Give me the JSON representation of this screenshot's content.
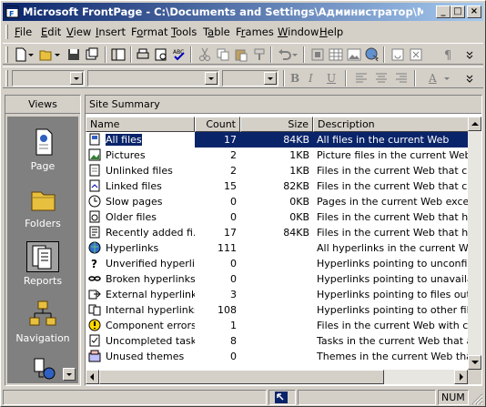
{
  "window": {
    "title": "Microsoft FrontPage - C:\\Documents and Settings\\Администратор\\Мои доку...",
    "minimize": "_",
    "maximize": "□",
    "close": "×"
  },
  "menu": [
    {
      "label": "File",
      "accel": "F"
    },
    {
      "label": "Edit",
      "accel": "E"
    },
    {
      "label": "View",
      "accel": "V"
    },
    {
      "label": "Insert",
      "accel": "I"
    },
    {
      "label": "Format",
      "accel": "o"
    },
    {
      "label": "Tools",
      "accel": "T"
    },
    {
      "label": "Table",
      "accel": "a"
    },
    {
      "label": "Frames",
      "accel": "r"
    },
    {
      "label": "Window",
      "accel": "W"
    },
    {
      "label": "Help",
      "accel": "H"
    }
  ],
  "format_toolbar": {
    "bold": "B",
    "italic": "I",
    "underline": "U",
    "font_color": "A"
  },
  "views": {
    "header": "Views",
    "items": [
      {
        "label": "Page",
        "icon": "page-icon"
      },
      {
        "label": "Folders",
        "icon": "folder-icon"
      },
      {
        "label": "Reports",
        "icon": "reports-icon",
        "selected": true
      },
      {
        "label": "Navigation",
        "icon": "navigation-icon"
      },
      {
        "label": "",
        "icon": "hyperlinks-view-icon"
      }
    ]
  },
  "report": {
    "title": "Site Summary",
    "columns": [
      "Name",
      "Count",
      "Size",
      "Description"
    ],
    "rows": [
      {
        "name": "All files",
        "count": "17",
        "size": "84KB",
        "description": "All files in the current Web",
        "icon": "all-files-icon",
        "selected": true
      },
      {
        "name": "Pictures",
        "count": "2",
        "size": "1KB",
        "description": "Picture files in the current Web (GIF, ",
        "icon": "pictures-icon"
      },
      {
        "name": "Unlinked files",
        "count": "2",
        "size": "1KB",
        "description": "Files in the current Web that cannot b",
        "icon": "unlinked-files-icon"
      },
      {
        "name": "Linked files",
        "count": "15",
        "size": "82KB",
        "description": "Files in the current Web that can be r",
        "icon": "linked-files-icon"
      },
      {
        "name": "Slow pages",
        "count": "0",
        "size": "0KB",
        "description": "Pages in the current Web exceeding a",
        "icon": "slow-pages-icon"
      },
      {
        "name": "Older files",
        "count": "0",
        "size": "0KB",
        "description": "Files in the current Web that have no",
        "icon": "older-files-icon"
      },
      {
        "name": "Recently added fi...",
        "count": "17",
        "size": "84KB",
        "description": "Files in the current Web that have be",
        "icon": "recent-files-icon"
      },
      {
        "name": "Hyperlinks",
        "count": "111",
        "size": "",
        "description": "All hyperlinks in the current Web",
        "icon": "hyperlinks-icon"
      },
      {
        "name": "Unverified hyperli...",
        "count": "0",
        "size": "",
        "description": "Hyperlinks pointing to unconfirmed ta",
        "icon": "unverified-hyperlinks-icon"
      },
      {
        "name": "Broken hyperlinks",
        "count": "0",
        "size": "",
        "description": "Hyperlinks pointing to unavailable targ",
        "icon": "broken-hyperlinks-icon"
      },
      {
        "name": "External hyperlinks",
        "count": "3",
        "size": "",
        "description": "Hyperlinks pointing to files outside of",
        "icon": "external-hyperlinks-icon"
      },
      {
        "name": "Internal hyperlinks",
        "count": "108",
        "size": "",
        "description": "Hyperlinks pointing to other files withi",
        "icon": "internal-hyperlinks-icon"
      },
      {
        "name": "Component errors",
        "count": "1",
        "size": "",
        "description": "Files in the current Web with compone",
        "icon": "component-errors-icon"
      },
      {
        "name": "Uncompleted tasks",
        "count": "8",
        "size": "",
        "description": "Tasks in the current Web that are not",
        "icon": "tasks-icon"
      },
      {
        "name": "Unused themes",
        "count": "0",
        "size": "",
        "description": "Themes in the current Web that are n",
        "icon": "themes-icon"
      }
    ]
  },
  "status": {
    "num": "NUM"
  },
  "colors": {
    "selection": "#0a246a",
    "face": "#d4d0c8",
    "views_bg": "#808080"
  }
}
